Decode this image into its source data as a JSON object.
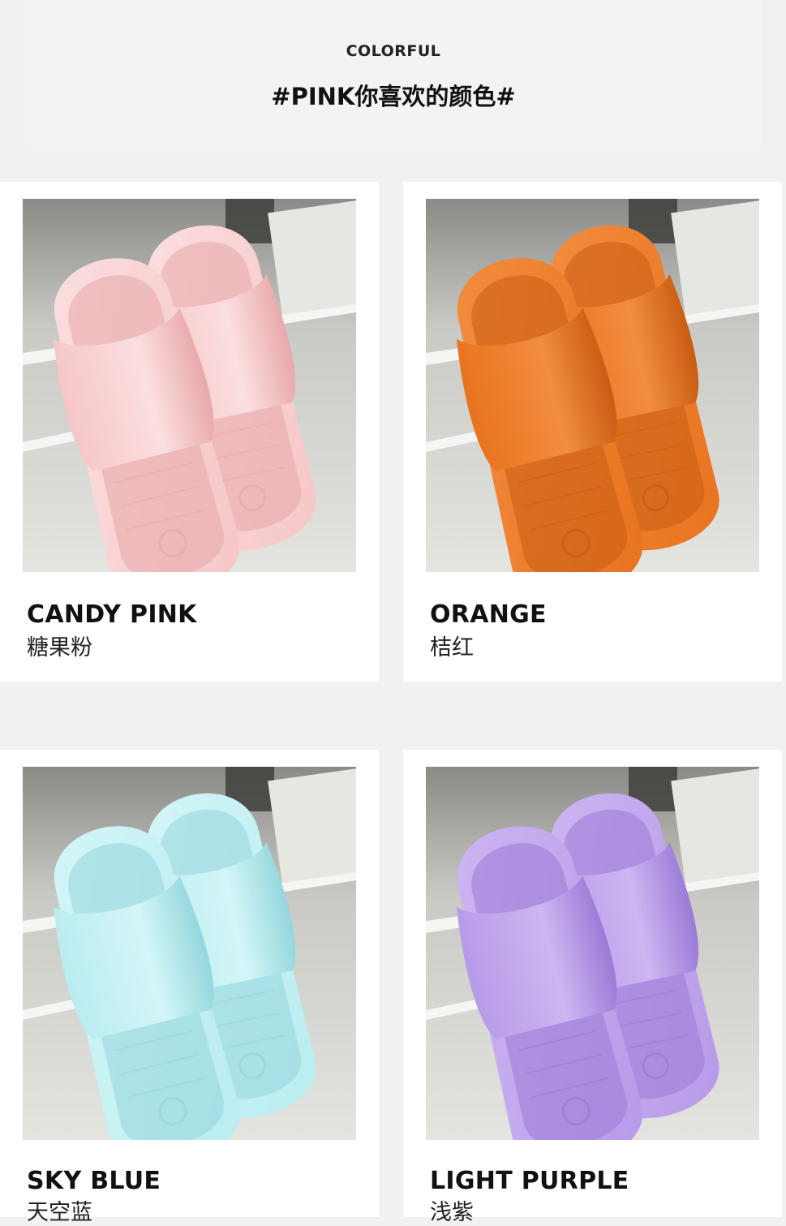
{
  "header": {
    "eyebrow": "COLORFUL",
    "title": "#PINK你喜欢的颜色#"
  },
  "products": [
    {
      "name_en": "CANDY PINK",
      "name_cn": "糖果粉",
      "colors": {
        "main": "#f6c6c7",
        "shade": "#e8a8aa",
        "light": "#fbdfe0"
      }
    },
    {
      "name_en": "ORANGE",
      "name_cn": "桔红",
      "colors": {
        "main": "#e8731f",
        "shade": "#c85c12",
        "light": "#f28d3e"
      }
    },
    {
      "name_en": "SKY BLUE",
      "name_cn": "天空蓝",
      "colors": {
        "main": "#b9ecf0",
        "shade": "#93d6dd",
        "light": "#d4f6f8"
      }
    },
    {
      "name_en": "LIGHT PURPLE",
      "name_cn": "浅紫",
      "colors": {
        "main": "#b79ae8",
        "shade": "#9a7ad6",
        "light": "#cdb6f2"
      }
    }
  ]
}
